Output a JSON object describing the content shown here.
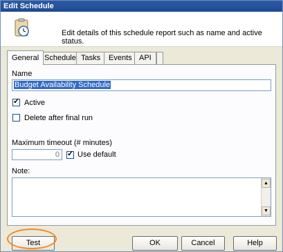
{
  "window": {
    "title": "Edit Schedule"
  },
  "header": {
    "description": "Edit details of this schedule report such as name and active status.",
    "icon": "clipboard-clock-icon"
  },
  "tabs": [
    {
      "label": "General",
      "active": true
    },
    {
      "label": "Schedule",
      "active": false
    },
    {
      "label": "Tasks",
      "active": false
    },
    {
      "label": "Events",
      "active": false
    },
    {
      "label": "API",
      "active": false
    }
  ],
  "general": {
    "name_label": "Name",
    "name_value": "Budget Availability Schedule",
    "active_label": "Active",
    "active_checked": true,
    "delete_label": "Delete after final run",
    "delete_checked": false,
    "timeout_label": "Maximum timeout (# minutes)",
    "timeout_value": "0",
    "use_default_label": "Use default",
    "use_default_checked": true,
    "note_label": "Note:"
  },
  "buttons": {
    "test": "Test",
    "ok": "OK",
    "cancel": "Cancel",
    "help": "Help"
  },
  "colors": {
    "highlight": "#f08a24",
    "title_bar": "#2c5aa4",
    "selection": "#316ac5"
  }
}
